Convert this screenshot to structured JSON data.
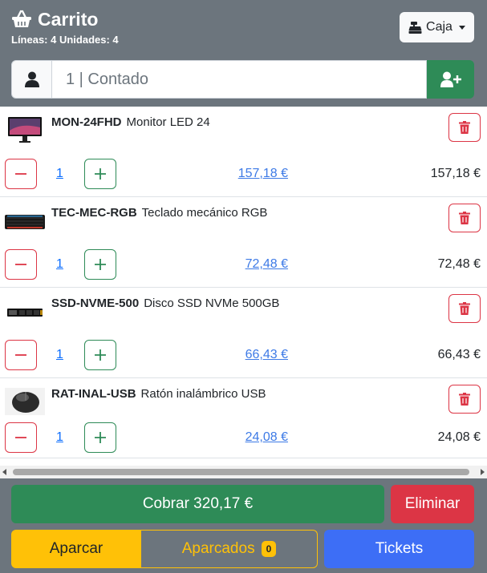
{
  "header": {
    "title": "Carrito",
    "subtitle": "Líneas: 4 Unidades: 4",
    "caja_label": "Caja"
  },
  "customer": {
    "value": "1 | Contado"
  },
  "items": [
    {
      "sku": "MON-24FHD",
      "name": "Monitor LED 24",
      "qty": "1",
      "price": "157,18 €",
      "total": "157,18 €"
    },
    {
      "sku": "TEC-MEC-RGB",
      "name": "Teclado mecánico RGB",
      "qty": "1",
      "price": "72,48 €",
      "total": "72,48 €"
    },
    {
      "sku": "SSD-NVME-500",
      "name": "Disco SSD NVMe 500GB",
      "qty": "1",
      "price": "66,43 €",
      "total": "66,43 €"
    },
    {
      "sku": "RAT-INAL-USB",
      "name": "Ratón inalámbrico USB",
      "qty": "1",
      "price": "24,08 €",
      "total": "24,08 €"
    }
  ],
  "footer": {
    "cobrar_label": "Cobrar 320,17 €",
    "eliminar_label": "Eliminar",
    "aparcar_label": "Aparcar",
    "aparcados_label": "Aparcados",
    "aparcados_count": "0",
    "tickets_label": "Tickets"
  },
  "colors": {
    "header_bg": "#6c757d",
    "success": "#2e8b57",
    "danger": "#dc3545",
    "warning": "#ffc107",
    "primary": "#3d6ef6"
  }
}
